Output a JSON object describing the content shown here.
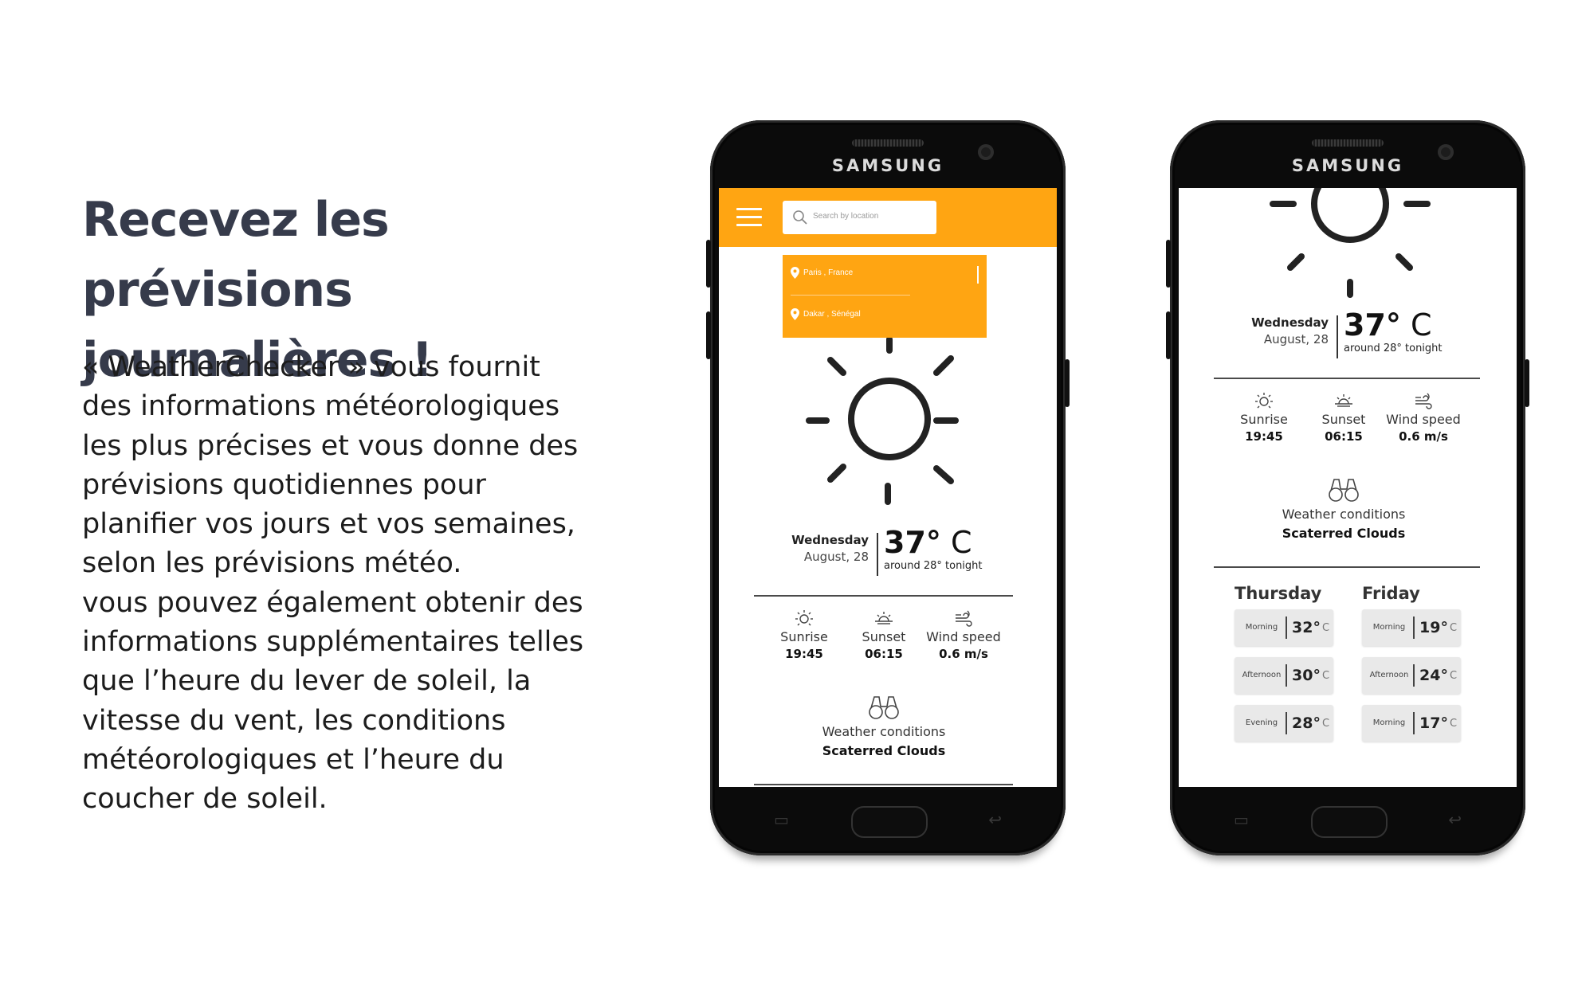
{
  "headline": {
    "line1": "Recevez les prévisions",
    "line2": "journalières !"
  },
  "description": [
    "« WeatherChecker » vous fournit",
    "des informations météorologiques",
    "les plus précises et vous donne des",
    "prévisions quotidiennes pour",
    "planifier vos jours et vos semaines,",
    "selon les prévisions météo.",
    "vous pouvez également obtenir des",
    "informations supplémentaires telles",
    "que l’heure du lever de soleil, la",
    "vitesse du vent, les conditions",
    "météorologiques et l’heure du",
    "coucher de soleil."
  ],
  "brand": "SAMSUNG",
  "colors": {
    "accent": "#ffa512",
    "text_dark": "#363b4b"
  },
  "phone1": {
    "search_placeholder": "Search by location",
    "locations": [
      "Paris , France",
      "Dakar , Sénégal"
    ],
    "weather": {
      "day": "Wednesday",
      "date": "August, 28",
      "temp": "37°",
      "unit": "C",
      "tonight": "around 28° tonight"
    },
    "stats": [
      {
        "icon": "sunrise-icon",
        "label": "Sunrise",
        "value": "19:45"
      },
      {
        "icon": "sunset-icon",
        "label": "Sunset",
        "value": "06:15"
      },
      {
        "icon": "wind-icon",
        "label": "Wind speed",
        "value": "0.6 m/s"
      }
    ],
    "conditions": {
      "label": "Weather conditions",
      "value": "Scaterred Clouds"
    }
  },
  "phone2": {
    "weather": {
      "day": "Wednesday",
      "date": "August, 28",
      "temp": "37°",
      "unit": "C",
      "tonight": "around 28° tonight"
    },
    "stats": [
      {
        "icon": "sunrise-icon",
        "label": "Sunrise",
        "value": "19:45"
      },
      {
        "icon": "sunset-icon",
        "label": "Sunset",
        "value": "06:15"
      },
      {
        "icon": "wind-icon",
        "label": "Wind speed",
        "value": "0.6 m/s"
      }
    ],
    "conditions": {
      "label": "Weather conditions",
      "value": "Scaterred Clouds"
    },
    "forecast": [
      {
        "day": "Thursday",
        "items": [
          {
            "part": "Morning",
            "temp": "32°",
            "unit": "C"
          },
          {
            "part": "Afternoon",
            "temp": "30°",
            "unit": "C"
          },
          {
            "part": "Evening",
            "temp": "28°",
            "unit": "C"
          }
        ]
      },
      {
        "day": "Friday",
        "items": [
          {
            "part": "Morning",
            "temp": "19°",
            "unit": "C"
          },
          {
            "part": "Afternoon",
            "temp": "24°",
            "unit": "C"
          },
          {
            "part": "Morning",
            "temp": "17°",
            "unit": "C"
          }
        ]
      }
    ]
  }
}
